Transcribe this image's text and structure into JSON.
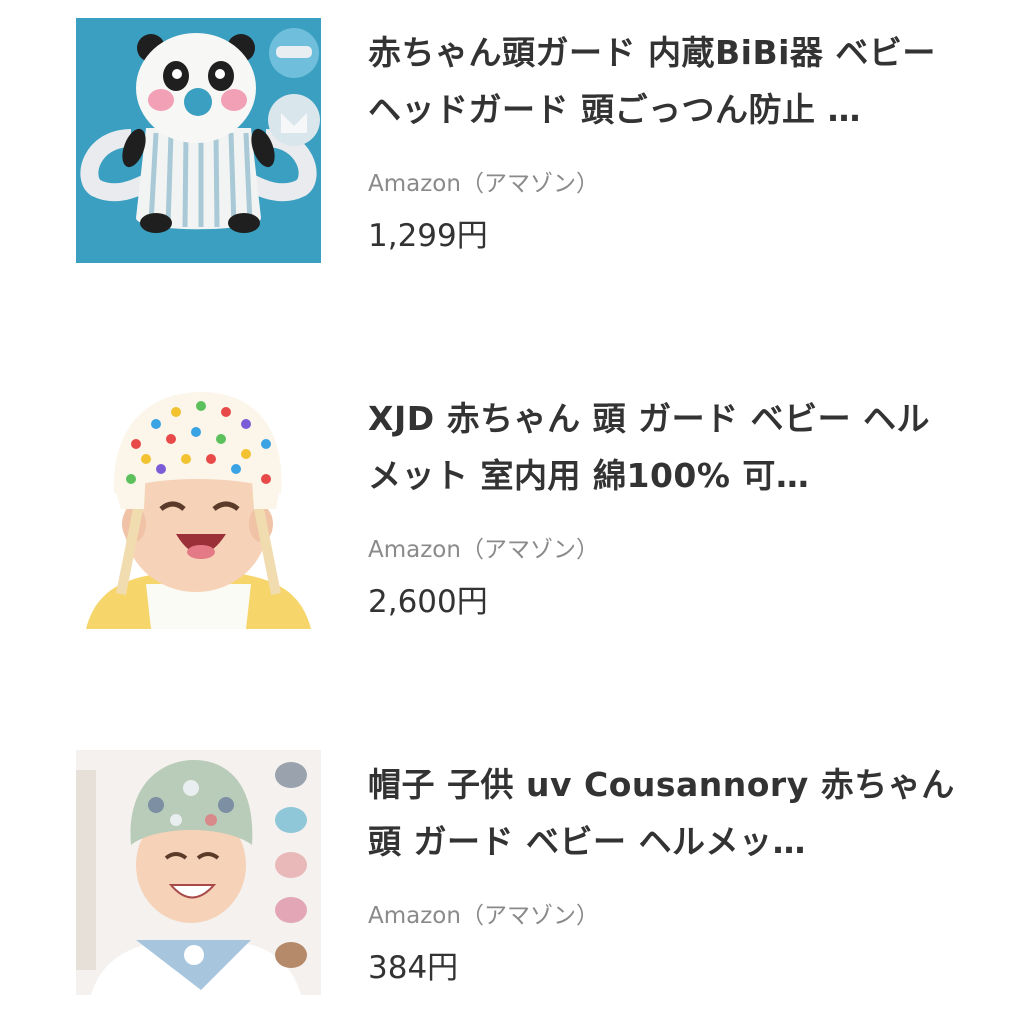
{
  "products": [
    {
      "image_icon": "panda-head-guard-image",
      "title": "赤ちゃん頭ガード 内蔵BiBi器 ベビーヘッドガード 頭ごっつん防止 …",
      "store": "Amazon（アマゾン）",
      "price": "1,299円"
    },
    {
      "image_icon": "baby-helmet-image",
      "title": "XJD 赤ちゃん 頭 ガード ベビー ヘルメット 室内用 綿100% 可…",
      "store": "Amazon（アマゾン）",
      "price": "2,600円"
    },
    {
      "image_icon": "toddler-uv-hat-image",
      "title": "帽子 子供 uv Cousannory 赤ちゃん 頭 ガード ベビー ヘルメッ…",
      "store": "Amazon（アマゾン）",
      "price": "384円"
    }
  ]
}
